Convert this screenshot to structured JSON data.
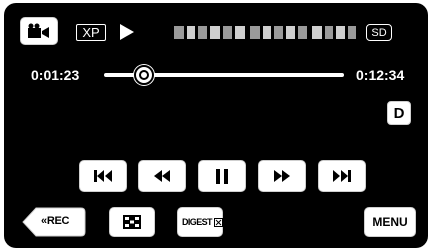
{
  "top_bar": {
    "mode_icon": "video-camera-icon",
    "quality_badge": "XP",
    "play_status_icon": "play-icon",
    "media_badge": "SD"
  },
  "timeline": {
    "elapsed": "0:01:23",
    "total": "0:12:34",
    "progress": 0.165
  },
  "delete_button": {
    "label": "D"
  },
  "transport": {
    "icons": [
      "skip-back-icon",
      "rewind-icon",
      "pause-icon",
      "fast-forward-icon",
      "skip-forward-icon"
    ]
  },
  "bottom_bar": {
    "rec_label": "«REC",
    "index_icon": "index-grid-icon",
    "digest_label": "DIGEST",
    "menu_label": "MENU"
  },
  "colors": {
    "screen": "#000000",
    "button_face": "#ffffff",
    "button_glyph": "#000000",
    "track": "#ffffff"
  }
}
